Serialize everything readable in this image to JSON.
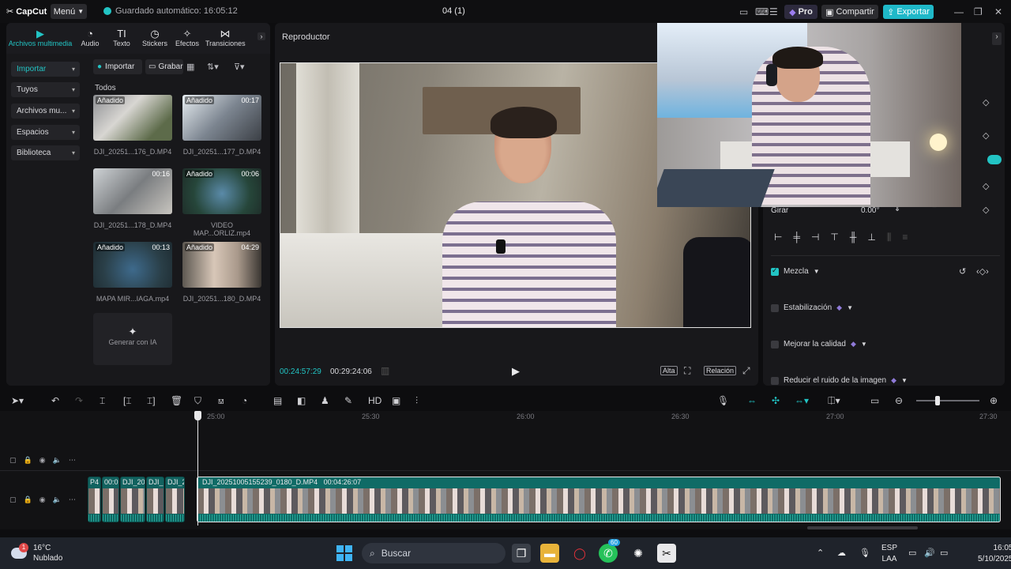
{
  "titlebar": {
    "logo": "CapCut",
    "menu_label": "Menú",
    "autosave": "Guardado automático: 16:05:12",
    "project_title": "04 (1)",
    "pro_label": "Pro",
    "share_label": "Compartir",
    "export_label": "Exportar"
  },
  "media": {
    "tabs": [
      {
        "label": "Archivos multimedia",
        "icon": "media-icon"
      },
      {
        "label": "Audio",
        "icon": "audio-icon"
      },
      {
        "label": "Texto",
        "icon": "text-icon"
      },
      {
        "label": "Stickers",
        "icon": "sticker-icon"
      },
      {
        "label": "Efectos",
        "icon": "effects-icon"
      },
      {
        "label": "Transiciones",
        "icon": "transitions-icon"
      }
    ],
    "sidenav": [
      {
        "label": "Importar"
      },
      {
        "label": "Tuyos"
      },
      {
        "label": "Archivos mu..."
      },
      {
        "label": "Espacios"
      },
      {
        "label": "Biblioteca"
      }
    ],
    "import_button": "Importar",
    "record_button": "Grabar",
    "section": "Todos",
    "items": [
      {
        "name": "DJI_20251...176_D.MP4",
        "badge": "Añadido",
        "duration": ""
      },
      {
        "name": "DJI_20251...177_D.MP4",
        "badge": "Añadido",
        "duration": "00:17"
      },
      {
        "name": "DJI_20251...178_D.MP4",
        "badge": "",
        "duration": "00:16"
      },
      {
        "name": "VIDEO MAP...ORLIZ.mp4",
        "badge": "Añadido",
        "duration": "00:06"
      },
      {
        "name": "MAPA MIR...IAGA.mp4",
        "badge": "Añadido",
        "duration": "00:13"
      },
      {
        "name": "DJI_20251...180_D.MP4",
        "badge": "Añadido",
        "duration": "04:29"
      }
    ],
    "generate_label": "Generar con IA"
  },
  "player": {
    "title": "Reproductor",
    "current_time": "00:24:57:29",
    "total_time": "00:29:24:06",
    "quality_label": "Alta",
    "ratio_label": "Relación"
  },
  "props": {
    "rotate_label": "Girar",
    "rotate_value": "0.00°",
    "blend_label": "Mezcla",
    "stabilize_label": "Estabilización",
    "enhance_label": "Mejorar la calidad",
    "denoise_label": "Reducir el ruido de la imagen"
  },
  "timeline": {
    "ruler": [
      "25:00",
      "25:30",
      "26:00",
      "26:30",
      "27:00",
      "27:30"
    ],
    "small_clips": [
      {
        "label": "P4"
      },
      {
        "label": "00:0"
      },
      {
        "label": "DJI_20"
      },
      {
        "label": "DJI_2"
      },
      {
        "label": "DJI_2"
      }
    ],
    "main_clip_name": "DJI_20251005155239_0180_D.MP4",
    "main_clip_duration": "00:04:26:07"
  },
  "taskbar": {
    "temperature": "16°C",
    "weather": "Nublado",
    "weather_badge": "1",
    "search_placeholder": "Buscar",
    "whatsapp_badge": "60",
    "lang_top": "ESP",
    "lang_bottom": "LAA",
    "time": "16:05",
    "date": "5/10/2025"
  },
  "colors": {
    "accent": "#22c4c4",
    "panel": "#18181b",
    "clip": "#0f6b66"
  }
}
